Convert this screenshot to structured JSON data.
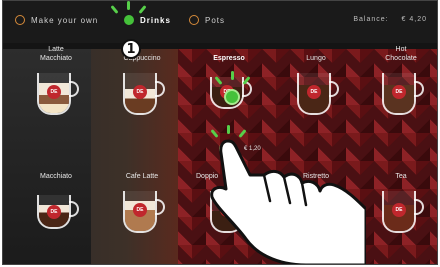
{
  "topbar": {
    "tabs": [
      {
        "label": "Make your own",
        "active": false
      },
      {
        "label": "Drinks",
        "active": true
      },
      {
        "label": "Pots",
        "active": false
      }
    ],
    "balance_label": "Balance:",
    "balance_value": "€ 4,20"
  },
  "step_number": "1",
  "products": [
    {
      "name": "Latte\nMacchiato",
      "liquid": "latte"
    },
    {
      "name": "Cappuccino",
      "liquid": "cappuccino"
    },
    {
      "name": "Espresso",
      "liquid": "espresso",
      "selected": true
    },
    {
      "name": "Lungo",
      "liquid": "lungo"
    },
    {
      "name": "Hot\nChocolate",
      "liquid": "chocolate"
    },
    {
      "name": "Macchiato",
      "liquid": "macchiato"
    },
    {
      "name": "Cafe Latte",
      "liquid": "latte"
    },
    {
      "name": "Doppio",
      "liquid": "doppio"
    },
    {
      "name": "Ristretto",
      "liquid": "ristretto"
    },
    {
      "name": "Tea",
      "liquid": "tea"
    }
  ],
  "selected_price": "€ 1,20",
  "logo_text": "DE",
  "colors": {
    "accent_green": "#45c13a",
    "tab_ring": "#d58a3a",
    "brand_red": "#c0272d"
  }
}
